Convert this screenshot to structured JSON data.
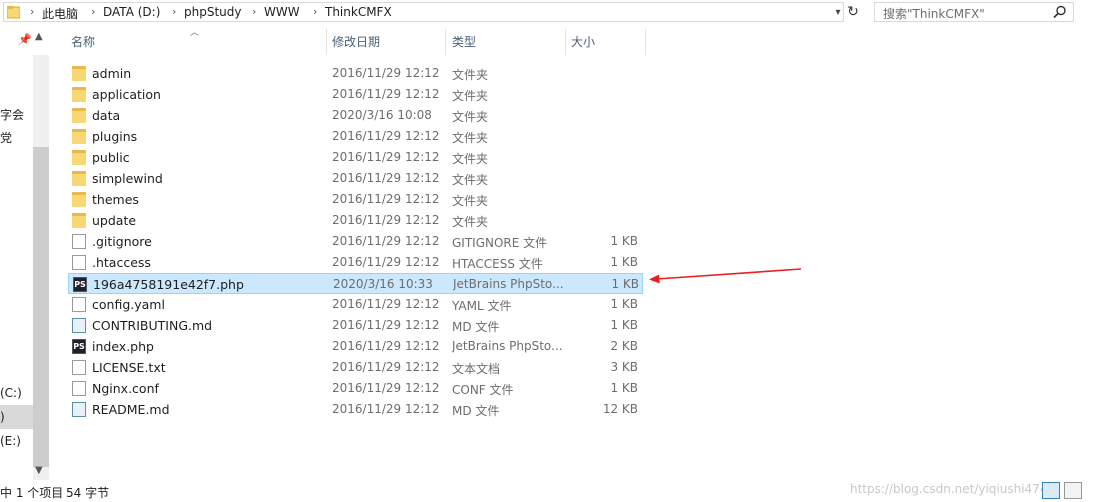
{
  "address": {
    "crumbs": [
      "此电脑",
      "DATA (D:)",
      "phpStudy",
      "WWW",
      "ThinkCMFX"
    ],
    "separator": "›"
  },
  "search": {
    "placeholder": "搜索\"ThinkCMFX\""
  },
  "nav": {
    "items": [
      "字会",
      "党",
      "(C:)",
      ")",
      "(E:)"
    ]
  },
  "columns": {
    "name": "名称",
    "date": "修改日期",
    "type": "类型",
    "size": "大小"
  },
  "files": [
    {
      "name": "admin",
      "date": "2016/11/29 12:12",
      "type": "文件夹",
      "size": "",
      "icon": "folder-icon"
    },
    {
      "name": "application",
      "date": "2016/11/29 12:12",
      "type": "文件夹",
      "size": "",
      "icon": "folder-icon"
    },
    {
      "name": "data",
      "date": "2020/3/16 10:08",
      "type": "文件夹",
      "size": "",
      "icon": "folder-icon"
    },
    {
      "name": "plugins",
      "date": "2016/11/29 12:12",
      "type": "文件夹",
      "size": "",
      "icon": "folder-icon"
    },
    {
      "name": "public",
      "date": "2016/11/29 12:12",
      "type": "文件夹",
      "size": "",
      "icon": "folder-icon"
    },
    {
      "name": "simplewind",
      "date": "2016/11/29 12:12",
      "type": "文件夹",
      "size": "",
      "icon": "folder-icon"
    },
    {
      "name": "themes",
      "date": "2016/11/29 12:12",
      "type": "文件夹",
      "size": "",
      "icon": "folder-icon"
    },
    {
      "name": "update",
      "date": "2016/11/29 12:12",
      "type": "文件夹",
      "size": "",
      "icon": "folder-icon"
    },
    {
      "name": ".gitignore",
      "date": "2016/11/29 12:12",
      "type": "GITIGNORE 文件",
      "size": "1 KB",
      "icon": "file-icon"
    },
    {
      "name": ".htaccess",
      "date": "2016/11/29 12:12",
      "type": "HTACCESS 文件",
      "size": "1 KB",
      "icon": "file-icon"
    },
    {
      "name": "196a4758191e42f7.php",
      "date": "2020/3/16 10:33",
      "type": "JetBrains PhpSto...",
      "size": "1 KB",
      "icon": "phpstorm-icon",
      "selected": true
    },
    {
      "name": "config.yaml",
      "date": "2016/11/29 12:12",
      "type": "YAML 文件",
      "size": "1 KB",
      "icon": "file-icon"
    },
    {
      "name": "CONTRIBUTING.md",
      "date": "2016/11/29 12:12",
      "type": "MD 文件",
      "size": "1 KB",
      "icon": "markdown-icon"
    },
    {
      "name": "index.php",
      "date": "2016/11/29 12:12",
      "type": "JetBrains PhpSto...",
      "size": "2 KB",
      "icon": "phpstorm-icon"
    },
    {
      "name": "LICENSE.txt",
      "date": "2016/11/29 12:12",
      "type": "文本文档",
      "size": "3 KB",
      "icon": "file-icon"
    },
    {
      "name": "Nginx.conf",
      "date": "2016/11/29 12:12",
      "type": "CONF 文件",
      "size": "1 KB",
      "icon": "file-icon"
    },
    {
      "name": "README.md",
      "date": "2016/11/29 12:12",
      "type": "MD 文件",
      "size": "12 KB",
      "icon": "markdown-icon"
    }
  ],
  "ps_label": "PS",
  "status": {
    "selected": "中 1 个项目",
    "size": "54 字节"
  },
  "watermark": "https://blog.csdn.net/yiqiushi4748",
  "colors": {
    "selection_bg": "#cce8ff",
    "selection_border": "#99d1ff",
    "annotation_arrow": "#e8201f",
    "header_text": "#4c607a"
  }
}
